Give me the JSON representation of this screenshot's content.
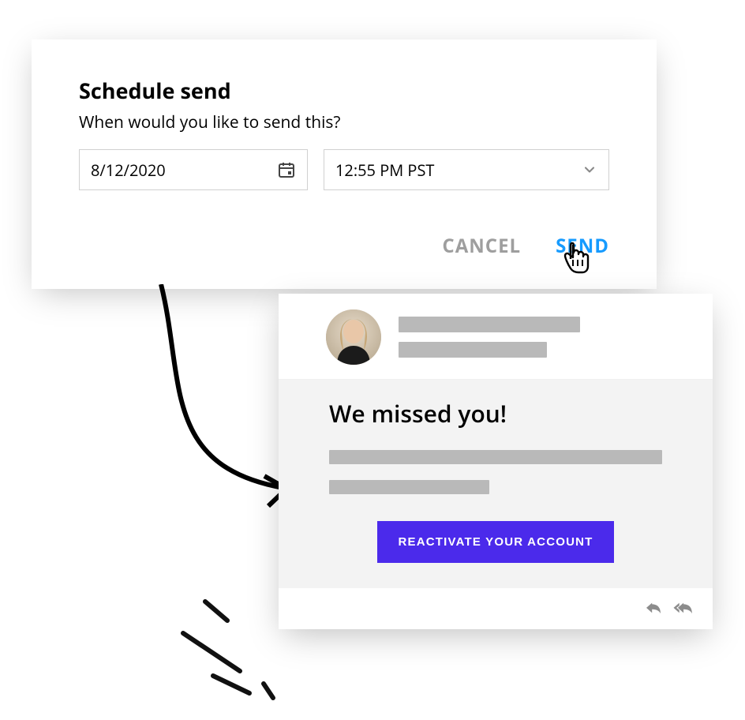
{
  "dialog": {
    "title": "Schedule send",
    "subtitle": "When would you like to send this?",
    "date_value": "8/12/2020",
    "time_value": "12:55 PM PST",
    "cancel_label": "CANCEL",
    "send_label": "SEND"
  },
  "email": {
    "subject": "We missed you!",
    "cta_label": "REACTIVATE YOUR ACCOUNT"
  },
  "colors": {
    "accent_blue": "#169BFF",
    "cta_purple": "#4B2AEB",
    "placeholder_gray": "#b9b9b9"
  }
}
